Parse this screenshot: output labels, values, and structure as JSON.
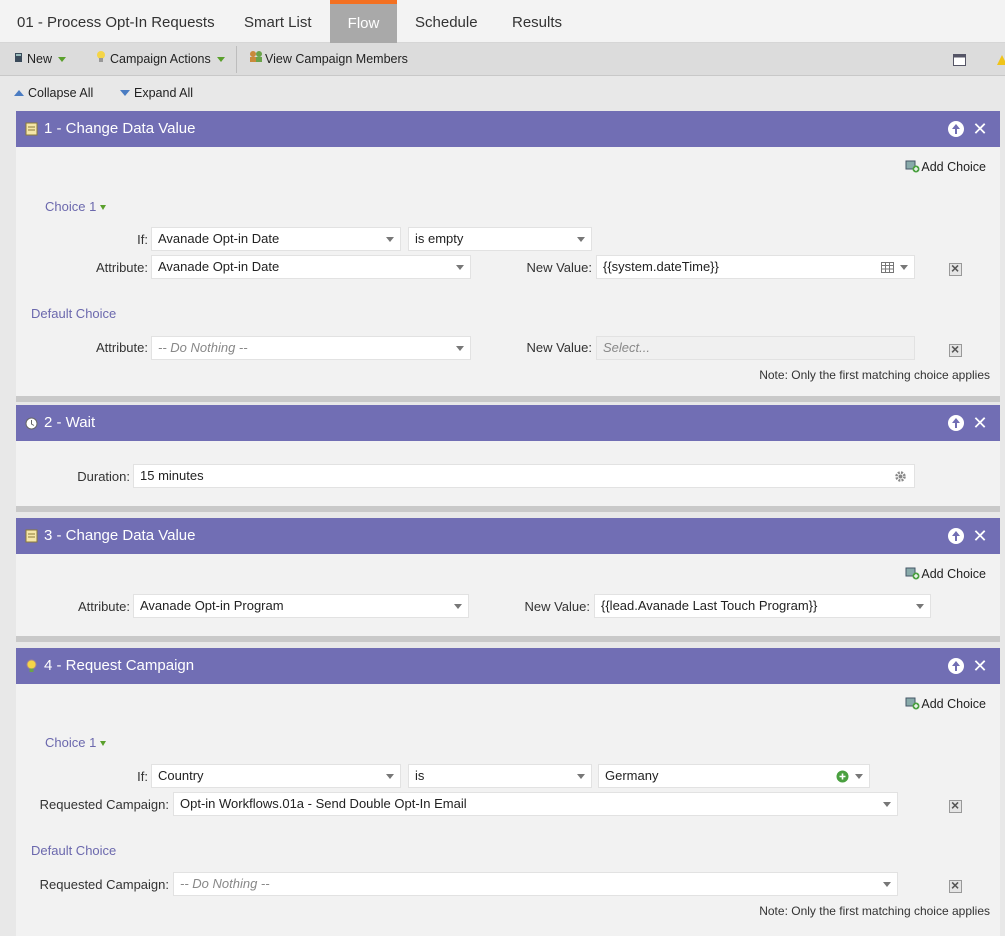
{
  "tabs": {
    "title": "01 - Process Opt-In Requests",
    "smart_list": "Smart List",
    "flow": "Flow",
    "schedule": "Schedule",
    "results": "Results"
  },
  "toolbar": {
    "new": "New",
    "campaign_actions": "Campaign Actions",
    "view_members": "View Campaign Members"
  },
  "collapse": {
    "collapse_all": "Collapse All",
    "expand_all": "Expand All"
  },
  "steps": [
    {
      "title": "1 - Change Data Value",
      "add_choice": "Add Choice",
      "choice_label": "Choice 1",
      "if_label": "If:",
      "if_field": "Avanade Opt-in Date",
      "if_operator": "is empty",
      "attribute_label": "Attribute:",
      "attribute_value": "Avanade Opt-in Date",
      "new_value_label": "New Value:",
      "new_value": "{{system.dateTime}}",
      "default_choice": "Default Choice",
      "default_attribute_label": "Attribute:",
      "default_attribute_value": "-- Do Nothing --",
      "default_new_value_label": "New Value:",
      "default_new_value_placeholder": "Select...",
      "note": "Note: Only the first matching choice applies"
    },
    {
      "title": "2 - Wait",
      "duration_label": "Duration:",
      "duration_value": "15 minutes"
    },
    {
      "title": "3 - Change Data Value",
      "add_choice": "Add Choice",
      "attribute_label": "Attribute:",
      "attribute_value": "Avanade Opt-in Program",
      "new_value_label": "New Value:",
      "new_value": "{{lead.Avanade Last Touch Program}}"
    },
    {
      "title": "4 - Request Campaign",
      "add_choice": "Add Choice",
      "choice_label": "Choice 1",
      "if_label": "If:",
      "if_field": "Country",
      "if_operator": "is",
      "if_value": "Germany",
      "requested_label": "Requested Campaign:",
      "requested_value": "Opt-in Workflows.01a - Send Double Opt-In Email",
      "default_choice": "Default Choice",
      "default_requested_label": "Requested Campaign:",
      "default_requested_value": "-- Do Nothing --",
      "note": "Note: Only the first matching choice applies"
    }
  ],
  "colors": {
    "header_purple": "#716eb4",
    "flow_tab_accent": "#f37021",
    "choice_label": "#6b68ad"
  }
}
